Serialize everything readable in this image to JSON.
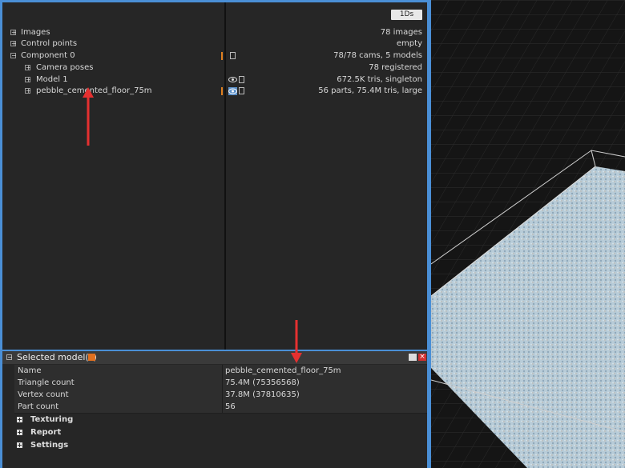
{
  "toolbar": {
    "button_label": "1Ds"
  },
  "scene_tree": {
    "rows": [
      {
        "label": "Images",
        "value": "78 images",
        "expander": "+"
      },
      {
        "label": "Control points",
        "value": "empty",
        "expander": "+"
      },
      {
        "label": "Component 0",
        "value": "78/78 cams, 5 models",
        "expander": "−"
      },
      {
        "label": "Camera poses",
        "value": "78 registered",
        "expander": "+"
      },
      {
        "label": "Model 1",
        "value": "672.5K tris, singleton",
        "expander": "+"
      },
      {
        "label": "pebble_cemented_floor_75m",
        "value": "56 parts, 75.4M tris, large",
        "expander": "+"
      }
    ]
  },
  "selected_panel": {
    "title": "Selected model(s)",
    "collapse": "−",
    "properties": [
      {
        "key": "Name",
        "value": "pebble_cemented_floor_75m"
      },
      {
        "key": "Triangle count",
        "value": "75.4M (75356568)"
      },
      {
        "key": "Vertex count",
        "value": "37.8M (37810635)"
      },
      {
        "key": "Part count",
        "value": "56"
      }
    ],
    "sections": [
      {
        "label": "Texturing",
        "toggle": "+"
      },
      {
        "label": "Report",
        "toggle": "+"
      },
      {
        "label": "Settings",
        "toggle": "+"
      }
    ]
  },
  "colors": {
    "accent_blue": "#4a8fd6",
    "highlight_orange": "#e08020",
    "annotation_red": "#e53030",
    "mesh": "#b8ccd8"
  }
}
